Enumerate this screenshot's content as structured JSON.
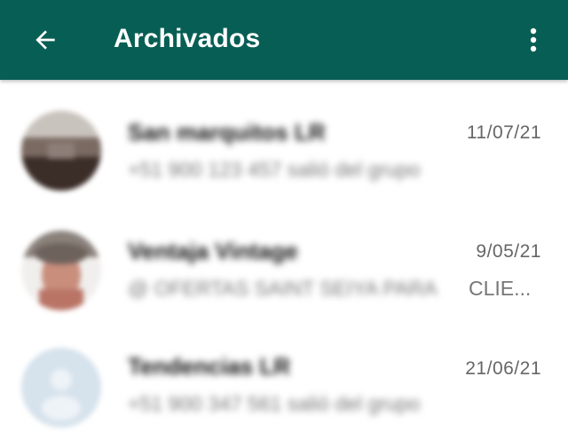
{
  "header": {
    "title": "Archivados",
    "back_icon": "arrow-left-icon",
    "menu_icon": "more-vertical-icon",
    "background_color": "#075e54"
  },
  "chats": [
    {
      "name": "San marquitos LR",
      "preview": "+51 900 123 457 salió del grupo",
      "date": "11/07/21",
      "avatar_icon": "group-photo-avatar"
    },
    {
      "name": "Ventaja Vintage",
      "preview": "@ OFERTAS SAINT SEIYA PARA",
      "preview_tail": "CLIE...",
      "date": "9/05/21",
      "avatar_icon": "group-photo-avatar"
    },
    {
      "name": "Tendencias LR",
      "preview": "+51 900 347 561 salió del grupo",
      "date": "21/06/21",
      "avatar_icon": "default-group-avatar"
    }
  ]
}
